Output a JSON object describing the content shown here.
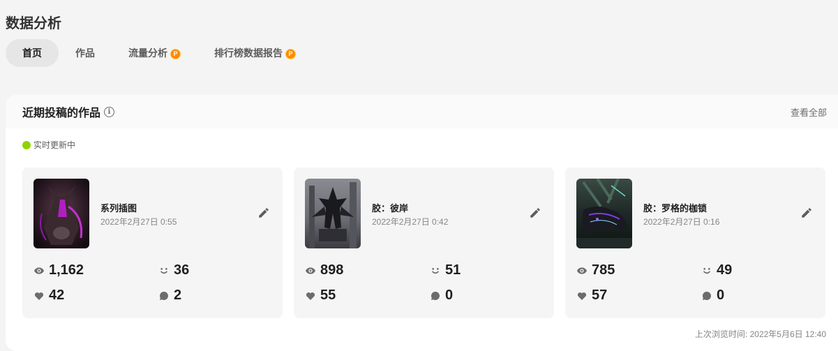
{
  "page": {
    "title": "数据分析"
  },
  "tabs": [
    {
      "label": "首页",
      "active": true,
      "premium": false
    },
    {
      "label": "作品",
      "active": false,
      "premium": false
    },
    {
      "label": "流量分析",
      "active": false,
      "premium": true
    },
    {
      "label": "排行榜数据报告",
      "active": false,
      "premium": true
    }
  ],
  "premium_badge_letter": "P",
  "panel": {
    "title": "近期投稿的作品",
    "info_symbol": "i",
    "view_all": "查看全部",
    "live_status": "实时更新中",
    "last_viewed": "上次浏览时间: 2022年5月6日 12:40"
  },
  "works": [
    {
      "title": "系列插图",
      "date": "2022年2月27日 0:55",
      "views": "1,162",
      "reactions": "36",
      "likes": "42",
      "comments": "2"
    },
    {
      "title": "胶：彼岸",
      "date": "2022年2月27日 0:42",
      "views": "898",
      "reactions": "51",
      "likes": "55",
      "comments": "0"
    },
    {
      "title": "胶：罗格的枷锁",
      "date": "2022年2月27日 0:16",
      "views": "785",
      "reactions": "49",
      "likes": "57",
      "comments": "0"
    }
  ],
  "colors": {
    "live_indicator": "#8fd400",
    "premium_badge": "#ff8a00",
    "active_tab": "#e6e6e6"
  }
}
